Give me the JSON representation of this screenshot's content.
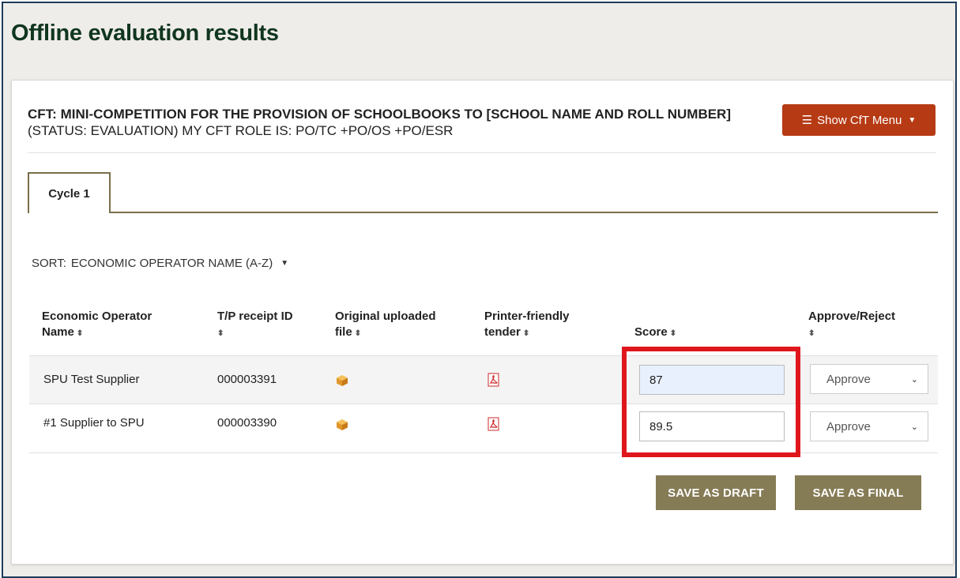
{
  "page": {
    "title": "Offline evaluation results"
  },
  "cft": {
    "prefix": "CFT:",
    "title": "MINI-COMPETITION FOR THE PROVISION OF SCHOOLBOOKS TO [SCHOOL NAME AND ROLL NUMBER]",
    "status": "(STATUS: EVALUATION) MY CFT ROLE IS:",
    "roles": "PO/TC +PO/OS +PO/ESR"
  },
  "menu_button": {
    "label": "Show CfT Menu",
    "icon": "list-icon"
  },
  "tabs": [
    {
      "label": "Cycle 1"
    }
  ],
  "sort": {
    "label": "SORT:",
    "value": "ECONOMIC OPERATOR NAME (A-Z)"
  },
  "table": {
    "headers": {
      "operator_line1": "Economic Operator",
      "operator_line2": "Name",
      "receipt": "T/P receipt ID",
      "original_line1": "Original uploaded",
      "original_line2": "file",
      "printer_line1": "Printer-friendly",
      "printer_line2": "tender",
      "score": "Score",
      "approve": "Approve/Reject"
    },
    "rows": [
      {
        "name": "SPU Test Supplier",
        "receipt_id": "000003391",
        "file_icon": "package-icon",
        "tender_icon": "pdf-icon",
        "score": "87",
        "decision": "Approve"
      },
      {
        "name": "#1 Supplier to SPU",
        "receipt_id": "000003390",
        "file_icon": "package-icon",
        "tender_icon": "pdf-icon",
        "score": "89.5",
        "decision": "Approve"
      }
    ]
  },
  "actions": {
    "draft": "SAVE AS DRAFT",
    "final": "SAVE AS FINAL"
  },
  "colors": {
    "title": "#10361f",
    "menu_button": "#b63a14",
    "action_button": "#857b55",
    "highlight": "#e0161d"
  }
}
